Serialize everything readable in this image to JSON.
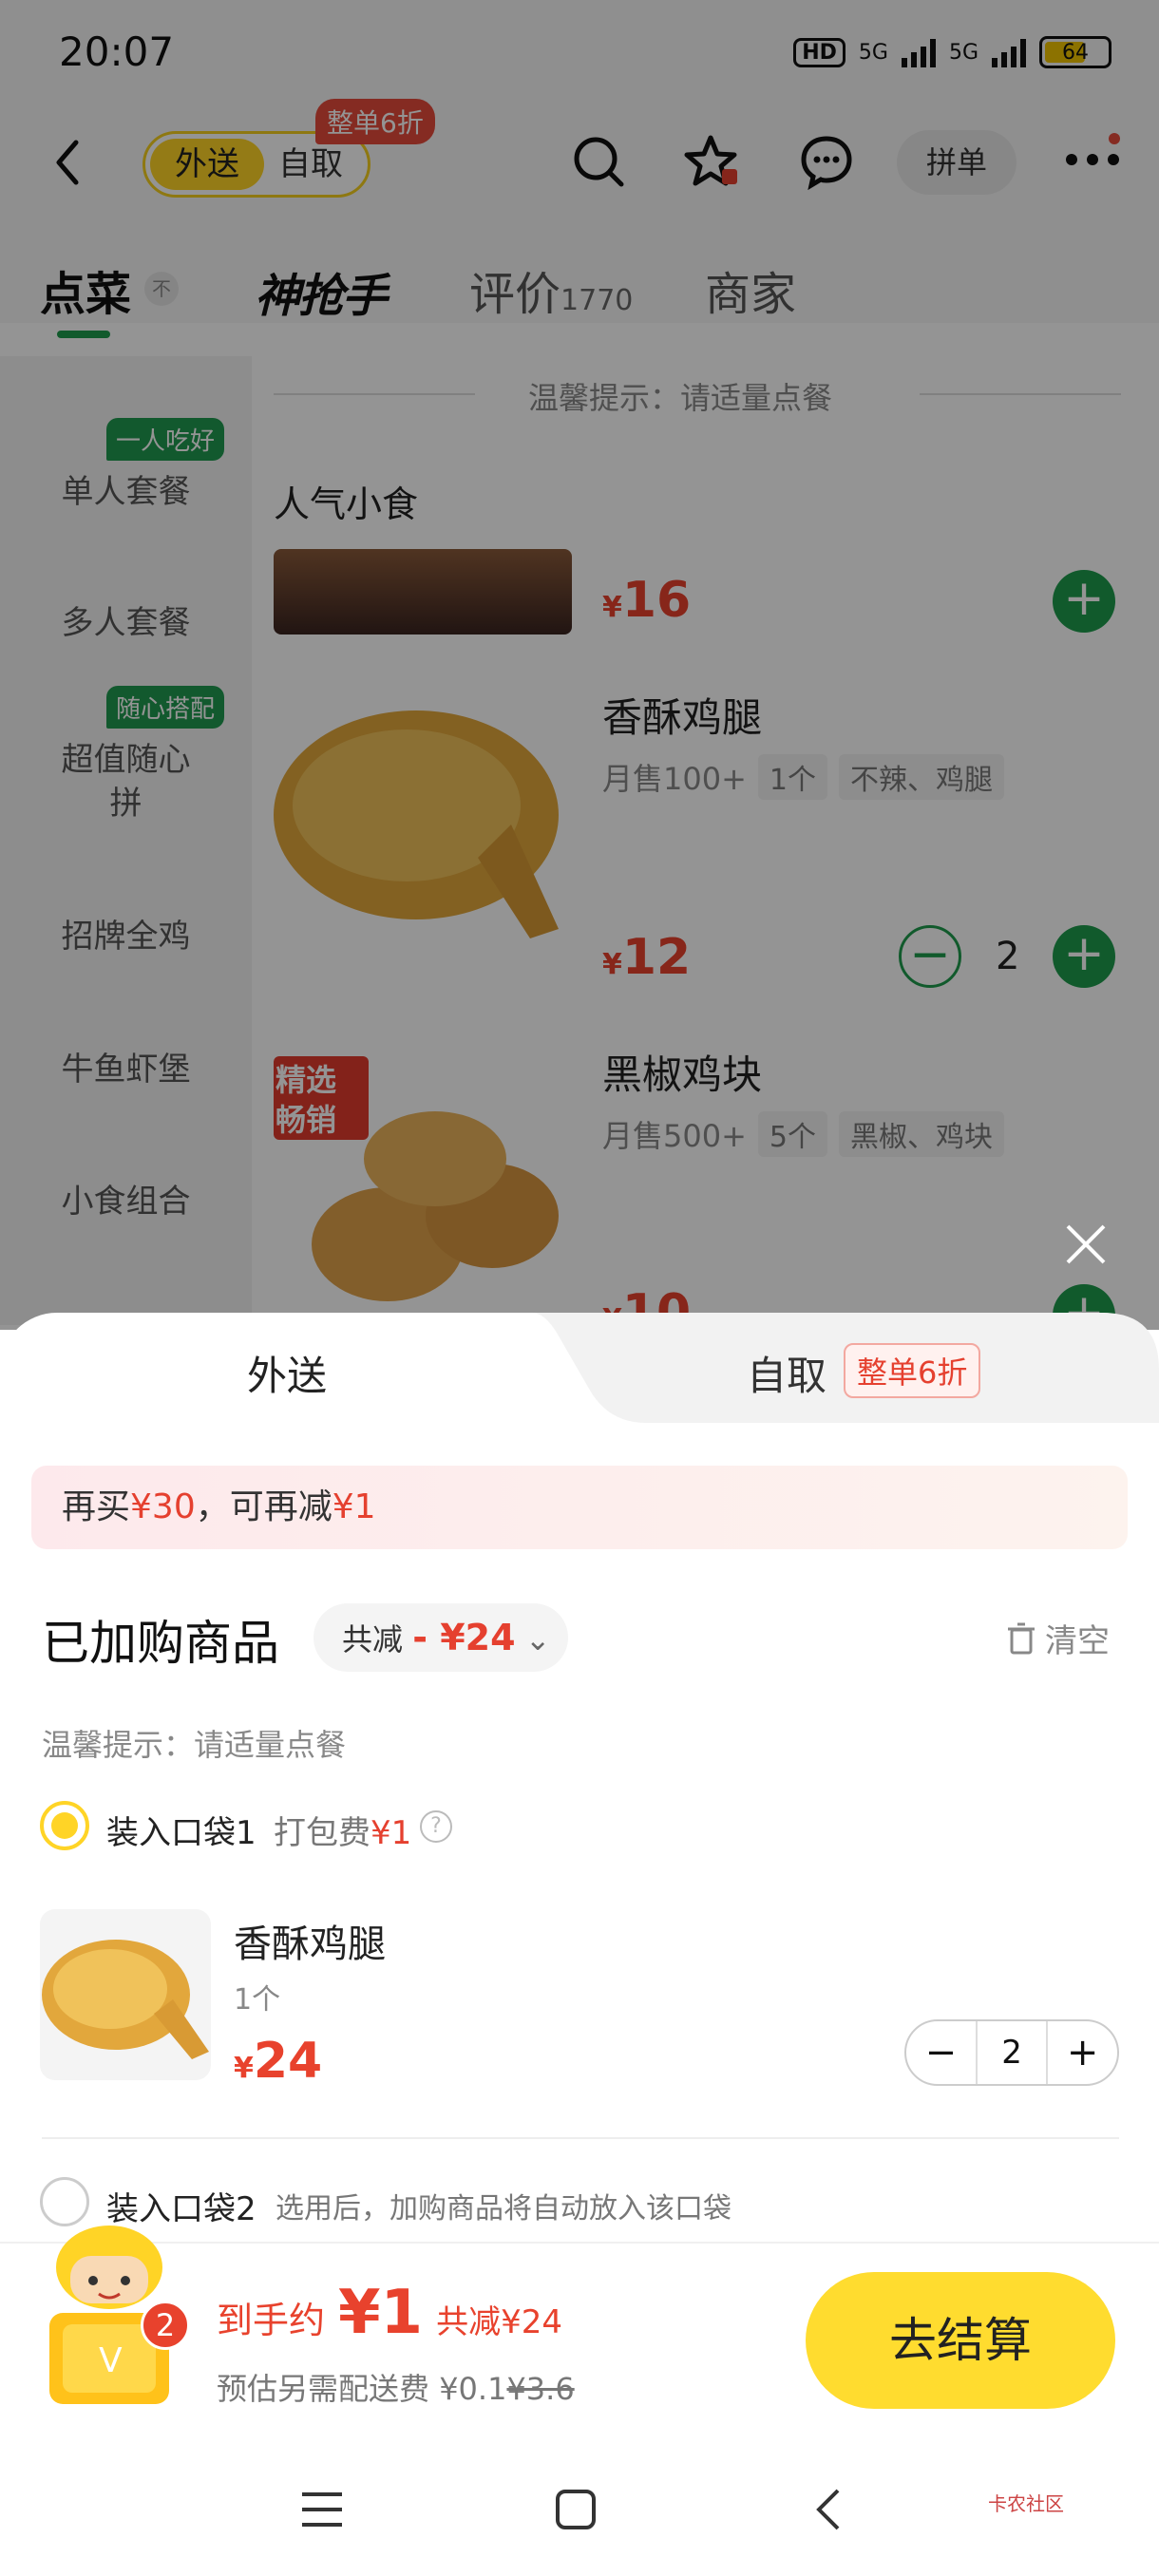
{
  "status_bar": {
    "time": "20:07",
    "network1": "5G",
    "network2": "5G",
    "battery": "64"
  },
  "header": {
    "mode_active": "外送",
    "mode_inactive": "自取",
    "mode_badge": "整单6折",
    "pindan": "拼单"
  },
  "tabs": [
    {
      "label": "点菜",
      "small": "不"
    },
    {
      "label": "神抢手"
    },
    {
      "label": "评价",
      "count": "1770"
    },
    {
      "label": "商家"
    }
  ],
  "sidebar": {
    "items": [
      "单人套餐",
      "多人套餐",
      "超值随心",
      "拼",
      "招牌全鸡",
      "牛鱼虾堡",
      "小食组合"
    ],
    "tags": [
      "一人吃好",
      "随心搭配"
    ]
  },
  "menu": {
    "tip": "温馨提示：请适量点餐",
    "section": "人气小食",
    "first_price": "16",
    "dishes": [
      {
        "name": "香酥鸡腿",
        "sales": "月售100+",
        "unit": "1个",
        "tags": "不辣、鸡腿",
        "price": "12",
        "qty": "2"
      },
      {
        "name": "黑椒鸡块",
        "sales": "月售500+",
        "unit": "5个",
        "tags": "黑椒、鸡块",
        "price": "10",
        "badge1": "精选",
        "badge2": "畅销"
      }
    ],
    "currency": "¥"
  },
  "sheet": {
    "tab_delivery": "外送",
    "tab_pickup": "自取",
    "pickup_badge": "整单6折",
    "promo": {
      "pre": "再买",
      "amount": "¥30",
      "mid": "，可再减",
      "off": "¥1"
    },
    "cart_title": "已加购商品",
    "discount_label": "共减",
    "discount_value": "- ¥24",
    "clear": "清空",
    "warm_tip": "温馨提示：请适量点餐",
    "bag1": {
      "label": "装入口袋1",
      "fee_label": "打包费",
      "fee": "¥1"
    },
    "item": {
      "name": "香酥鸡腿",
      "spec": "1个",
      "price": "24",
      "qty": "2"
    },
    "bag2": {
      "label": "装入口袋2",
      "hint": "选用后，加购商品将自动放入该口袋"
    }
  },
  "footer": {
    "cart_count": "2",
    "final_label": "到手约",
    "final_value": "¥1",
    "saved": "共减¥24",
    "fee_label": "预估另需配送费",
    "fee_now": "¥0.1",
    "fee_orig": "¥3.6",
    "checkout": "去结算"
  },
  "watermark": "卡农社区",
  "colors": {
    "brand_yellow": "#ffd426",
    "brand_green": "#1e9b4d",
    "price_red": "#e8422d"
  }
}
